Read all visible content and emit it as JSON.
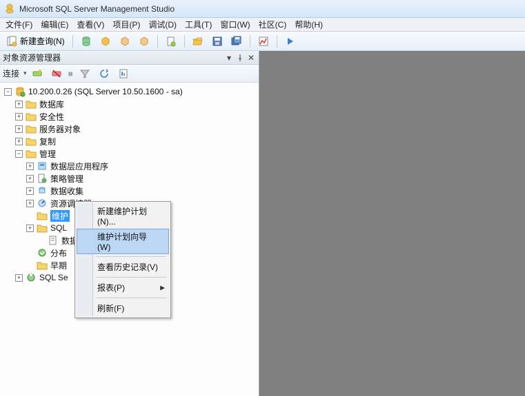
{
  "title": "Microsoft SQL Server Management Studio",
  "menus": {
    "file": "文件(F)",
    "edit": "编辑(E)",
    "view": "查看(V)",
    "project": "项目(P)",
    "debug": "调试(D)",
    "tools": "工具(T)",
    "window": "窗口(W)",
    "community": "社区(C)",
    "help": "帮助(H)"
  },
  "toolbar": {
    "newquery": "新建查询(N)"
  },
  "panel": {
    "title": "对象资源管理器",
    "connect": "连接"
  },
  "tree": {
    "server": "10.200.0.26 (SQL Server 10.50.1600 - sa)",
    "n1": "数据库",
    "n2": "安全性",
    "n3": "服务器对象",
    "n4": "复制",
    "n5": "管理",
    "n5a": "数据层应用程序",
    "n5b": "策略管理",
    "n5c": "数据收集",
    "n5d": "资源调控器",
    "n5e": "维护",
    "n5f": "SQL",
    "n5fa": "数据",
    "n5g": "分布",
    "n5h": "早期",
    "n6": "SQL Se"
  },
  "context": {
    "c1": "新建维护计划(N)...",
    "c2": "维护计划向导(W)",
    "c3": "查看历史记录(V)",
    "c4": "报表(P)",
    "c5": "刷新(F)"
  }
}
